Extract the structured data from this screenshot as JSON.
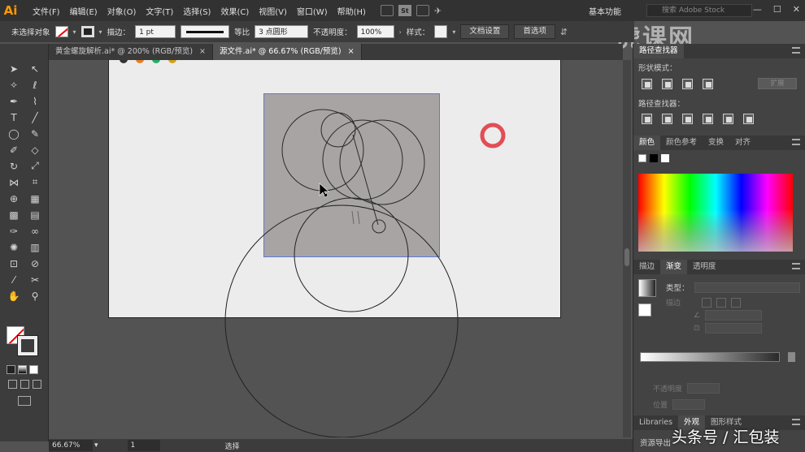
{
  "app": {
    "logo": "Ai",
    "workspace": "基本功能",
    "stock_search_placeholder": "搜索 Adobe Stock"
  },
  "menu": [
    "文件(F)",
    "编辑(E)",
    "对象(O)",
    "文字(T)",
    "选择(S)",
    "效果(C)",
    "视图(V)",
    "窗口(W)",
    "帮助(H)"
  ],
  "menu_icon_st": "St",
  "control": {
    "no_selection": "未选择对象",
    "stroke_label": "描边：",
    "stroke_weight": "1 pt",
    "stroke_profile": "等比",
    "brush": "3 点圆形",
    "opacity_label": "不透明度：",
    "opacity_value": "100%",
    "style_label": "样式：",
    "doc_setup_btn": "文档设置",
    "prefs_btn": "首选项"
  },
  "tabs": [
    {
      "label": "黄金螺旋解析.ai* @ 200% (RGB/预览)",
      "active": false
    },
    {
      "label": "源文件.ai* @ 66.67% (RGB/预览)",
      "active": true
    }
  ],
  "tab_close": "×",
  "status": {
    "zoom": "66.67%",
    "page": "1",
    "mode": "选择"
  },
  "pathfinder": {
    "title": "路径查找器",
    "shape_modes": "形状模式：",
    "expand": "扩展",
    "pathfinders": "路径查找器："
  },
  "color_panel": {
    "tabs": [
      "颜色",
      "颜色参考",
      "变换",
      "对齐"
    ]
  },
  "gradient_panel": {
    "tabs": [
      "描边",
      "渐变",
      "透明度"
    ],
    "type_label": "类型：",
    "stroke_label": "描边",
    "opacity_label": "不透明度",
    "location_label": "位置"
  },
  "bottom_tabs": [
    "Libraries",
    "外观",
    "图形样式"
  ],
  "asset_export": "资源导出",
  "watermark_text": "头条号 / 汇包装",
  "logo_watermark": "虎课网",
  "colors": {
    "accent_selection": "#5a7bd6",
    "cursor_ring": "#e0323c",
    "ai_orange": "#ff9a00"
  }
}
